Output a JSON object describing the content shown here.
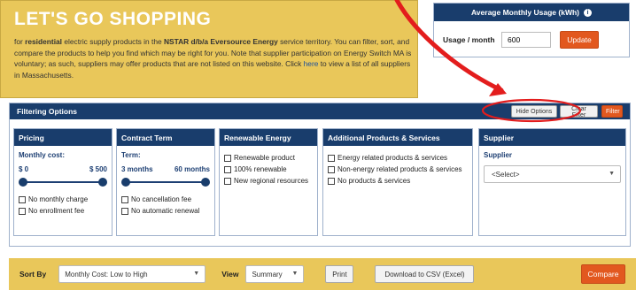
{
  "hero": {
    "title": "LET'S GO SHOPPING",
    "text_1": "for",
    "text_2": "residential",
    "text_3": "electric supply products in the",
    "text_4": "NSTAR d/b/a Eversource Energy",
    "text_5": "service territory. You can filter, sort, and compare the products to help you find which may be right for you. Note that supplier participation on Energy Switch MA is voluntary; as such, suppliers may offer products that are not listed on this website. Click",
    "link": "here",
    "text_6": "to view a list of all suppliers in Massachusetts."
  },
  "usage": {
    "title": "Average Monthly Usage (kWh)",
    "info_icon": "i",
    "label": "Usage / month",
    "value": "600",
    "button": "Update"
  },
  "filter": {
    "title": "Filtering Options",
    "hide_btn": "Hide Options",
    "clear_btn": "Clear Filter",
    "filter_btn": "Filter",
    "pricing": {
      "title": "Pricing",
      "sub": "Monthly cost:",
      "min": "$ 0",
      "max": "$ 500",
      "checks": [
        "No monthly charge",
        "No enrollment fee"
      ]
    },
    "contract": {
      "title": "Contract Term",
      "sub": "Term:",
      "min": "3 months",
      "max": "60 months",
      "checks": [
        "No cancellation fee",
        "No automatic renewal"
      ]
    },
    "renewable": {
      "title": "Renewable Energy",
      "checks": [
        "Renewable product",
        "100% renewable",
        "New regional resources"
      ]
    },
    "additional": {
      "title": "Additional Products & Services",
      "checks": [
        "Energy related products & services",
        "Non-energy related products & services",
        "No products & services"
      ]
    },
    "supplier": {
      "title": "Supplier",
      "sub": "Supplier",
      "select": "<Select>"
    }
  },
  "toolbar": {
    "sort_label": "Sort By",
    "sort_value": "Monthly Cost: Low to High",
    "view_label": "View",
    "view_value": "Summary",
    "print": "Print",
    "download": "Download to CSV (Excel)",
    "compare": "Compare"
  },
  "colors": {
    "navy": "#193d6c",
    "gold": "#e9c75a",
    "orange": "#e2581f",
    "annotation": "#e31d1d"
  }
}
